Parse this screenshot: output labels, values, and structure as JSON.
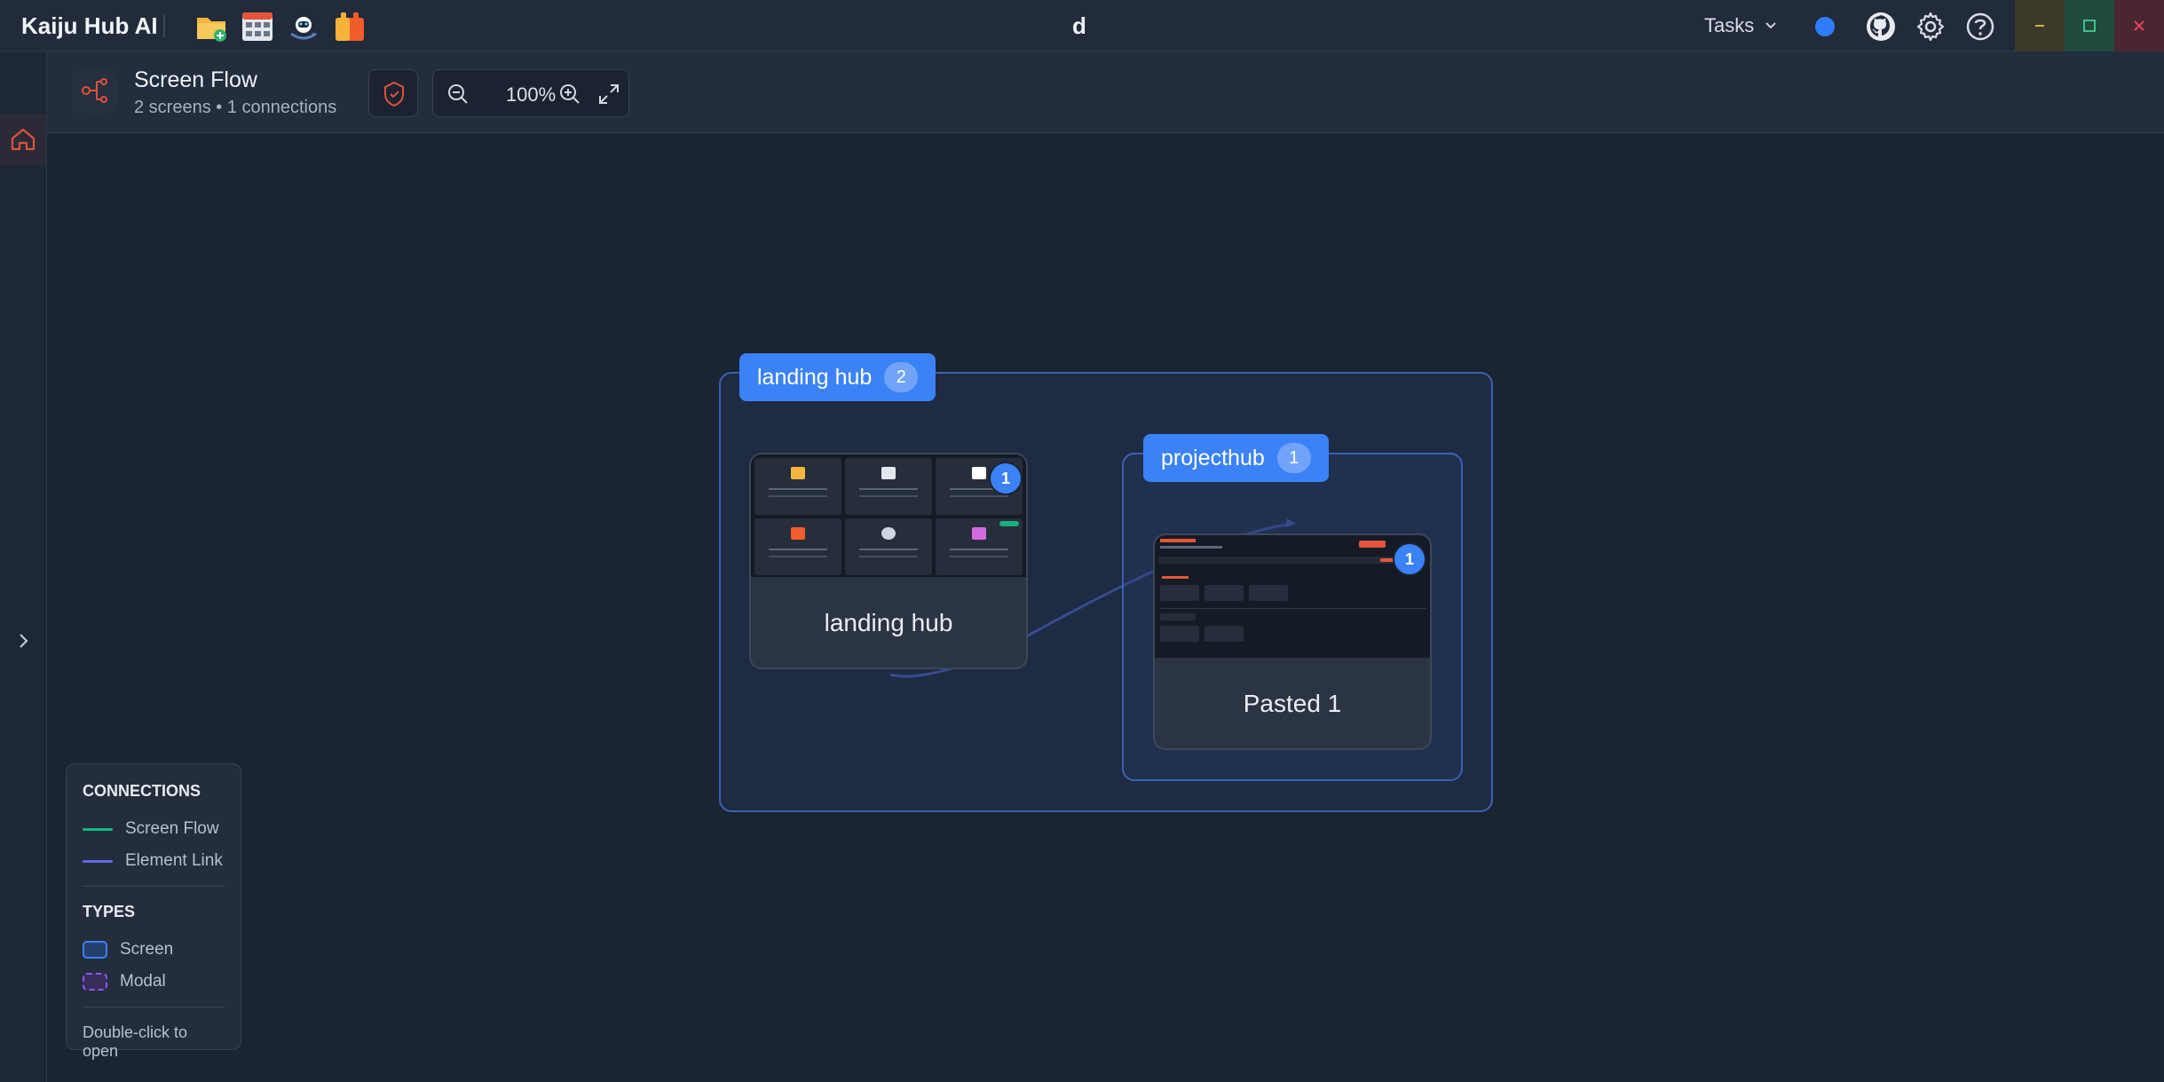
{
  "app": {
    "title": "Kaiju Hub AI",
    "window_title": "d"
  },
  "header": {
    "tasks_label": "Tasks"
  },
  "toolbar": {
    "title": "Screen Flow",
    "subtitle": "2 screens • 1 connections",
    "zoom_level": "100%"
  },
  "canvas": {
    "groups": [
      {
        "label": "landing hub",
        "count": "2"
      },
      {
        "label": "projecthub",
        "count": "1"
      }
    ],
    "nodes": [
      {
        "label": "landing hub",
        "badge": "1"
      },
      {
        "label": "Pasted 1",
        "badge": "1"
      }
    ]
  },
  "legend": {
    "connections_title": "CONNECTIONS",
    "screen_flow": "Screen Flow",
    "element_link": "Element Link",
    "types_title": "TYPES",
    "screen": "Screen",
    "modal": "Modal",
    "note": "Double-click to open"
  },
  "colors": {
    "accent": "#3b82f6",
    "screen_flow": "#10b981",
    "element_link": "#6366f1",
    "modal": "#8b5cf6",
    "brand_orange": "#e5543a"
  }
}
